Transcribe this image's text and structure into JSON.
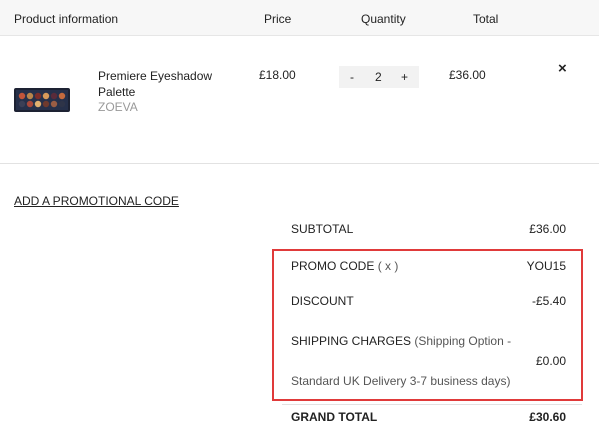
{
  "header": {
    "product_info": "Product information",
    "price": "Price",
    "quantity": "Quantity",
    "total": "Total"
  },
  "item": {
    "name": "Premiere Eyeshadow Palette",
    "brand": "ZOEVA",
    "price": "£18.00",
    "quantity": "2",
    "minus": "-",
    "plus": "+",
    "total": "£36.00",
    "remove": "×"
  },
  "promo_link": "ADD A PROMOTIONAL CODE",
  "summary": {
    "subtotal_label": "SUBTOTAL",
    "subtotal_value": "£36.00",
    "promo_label": "PROMO CODE",
    "promo_remove": "( x )",
    "promo_value": "YOU15",
    "discount_label": "DISCOUNT",
    "discount_value": "-£5.40",
    "shipping_label": "SHIPPING CHARGES",
    "shipping_option_line1": "(Shipping Option -",
    "shipping_option_line2": "Standard UK Delivery 3-7 business days)",
    "shipping_value": "£0.00",
    "grand_total_label": "GRAND TOTAL",
    "grand_total_value": "£30.60"
  },
  "colors": {
    "highlight_border": "#e03a3a",
    "header_bg": "#f7f7f7"
  }
}
